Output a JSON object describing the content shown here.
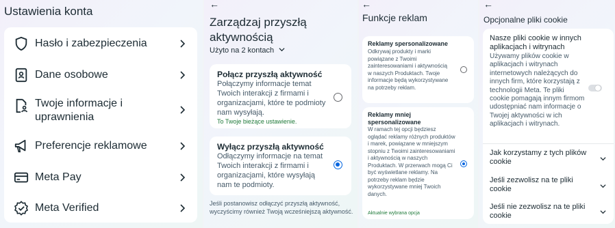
{
  "account_settings": {
    "title": "Ustawienia konta",
    "items": [
      {
        "label": "Hasło i zabezpieczenia",
        "icon": "shield-icon"
      },
      {
        "label": "Dane osobowe",
        "icon": "id-card-icon"
      },
      {
        "label": "Twoje informacje i uprawnienia",
        "icon": "document-user-icon"
      },
      {
        "label": "Preferencje reklamowe",
        "icon": "megaphone-icon"
      },
      {
        "label": "Meta Pay",
        "icon": "card-icon"
      },
      {
        "label": "Meta Verified",
        "icon": "verified-badge-icon"
      }
    ]
  },
  "future_activity": {
    "title": "Zarządzaj przyszłą aktywnością",
    "used_on": "Użyto na 2 kontach",
    "options": [
      {
        "title": "Połącz przyszłą aktywność",
        "description": "Połączymy informacje temat Twoich interakcji z firmami i organizacjami, które te podmioty nam wysyłają.",
        "note": "To Twoje bieżące ustawienie.",
        "selected": false
      },
      {
        "title": "Wyłącz przyszłą aktywność",
        "description": "Odłączymy informacje na temat Twoich interakcji z firmami i organizacjami, które wysyłają nam te podmioty.",
        "note": "",
        "selected": true
      }
    ],
    "footer": "Jeśli postanowisz odłączyć przyszłą aktywność, wyczyścimy również Twoją wcześniejszą aktywność."
  },
  "ad_features": {
    "title": "Funkcje reklam",
    "options": [
      {
        "title": "Reklamy spersonalizowane",
        "description": "Odkrywaj produkty i marki powiązane z Twoimi zainteresowaniami i aktywnością w naszych Produktach. Twoje informacje będą wykorzystywane na potrzeby reklam.",
        "note": "",
        "selected": false
      },
      {
        "title": "Reklamy mniej spersonalizowane",
        "description": "W ramach tej opcji będziesz oglądać reklamy różnych produktów i marek, powiązane w mniejszym stopniu z Twoimi zainteresowaniami i aktywnością w naszych Produktach. W przerwach mogą Ci być wyświetlane reklamy. Na potrzeby reklam będzie wykorzystywane mniej Twoich danych.",
        "note": "Aktualnie wybrana opcja",
        "selected": true
      }
    ]
  },
  "optional_cookies": {
    "title": "Opcjonalne pliki cookie",
    "main": {
      "title": "Nasze pliki cookie w innych aplikacjach i witrynach",
      "description": "Używamy plików cookie w aplikacjach i witrynach internetowych należących do innych firm, które korzystają z technologii Meta. Te pliki cookie pomagają innym firmom udostępniać nam informacje o Twojej aktywności w ich aplikacjach i witrynach.",
      "enabled": false
    },
    "sections": [
      {
        "label": "Jak korzystamy z tych plików cookie"
      },
      {
        "label": "Jeśli zezwolisz na te pliki cookie"
      },
      {
        "label": "Jeśli nie zezwolisz na te pliki cookie"
      }
    ]
  },
  "colors": {
    "accent": "#0064e0",
    "green_note": "#1f7a3a",
    "text": "#1c2b33"
  }
}
